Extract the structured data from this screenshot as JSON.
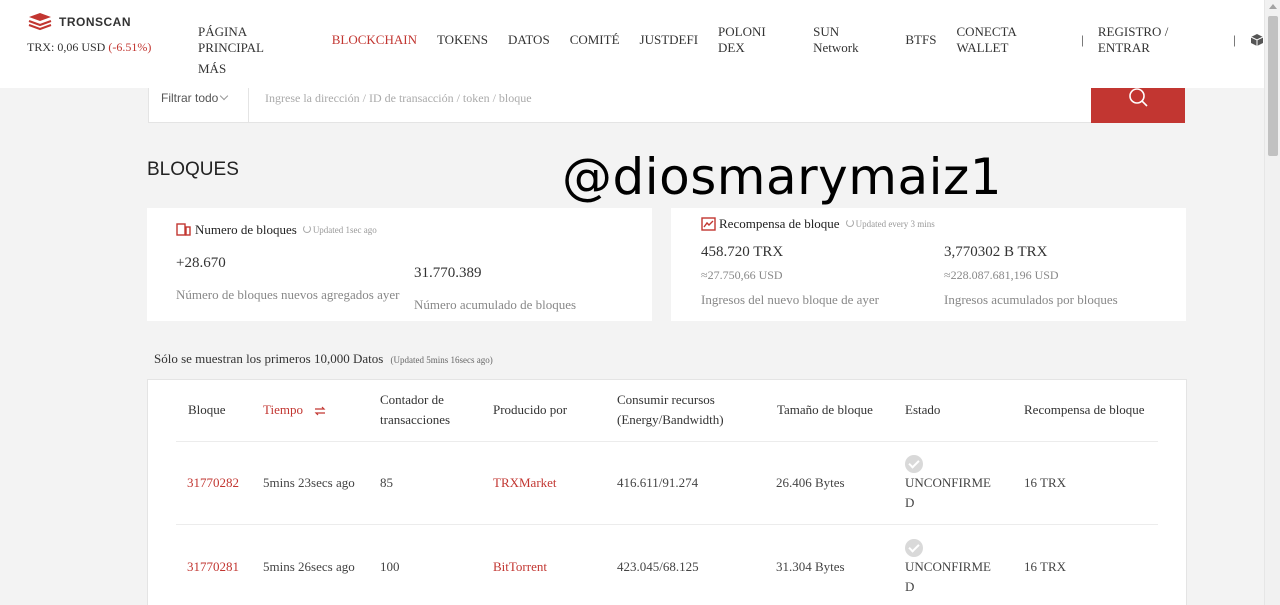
{
  "header": {
    "logo_text": "TRONSCAN",
    "trx_price": "TRX: 0,06 USD",
    "trx_change": "(-6.51%)",
    "nav": [
      "PÁGINA PRINCIPAL",
      "BLOCKCHAIN",
      "TOKENS",
      "DATOS",
      "COMITÉ",
      "JUSTDEFI",
      "POLONI DEX",
      "SUN Network",
      "BTFS",
      "CONECTA WALLET"
    ],
    "nav_active": "BLOCKCHAIN",
    "register": "REGISTRO / ENTRAR",
    "more": "MÁS",
    "separator": "|"
  },
  "search": {
    "filter": "Filtrar todo",
    "placeholder": "Ingrese la dirección / ID de transacción / token / bloque"
  },
  "page_title": "BLOQUES",
  "watermark": "@diosmarymaiz1",
  "blocks_card": {
    "title": "Numero de bloques",
    "updated": "Updated  1sec ago",
    "new_blocks": "+28.670",
    "new_blocks_label": "Número de bloques nuevos agregados ayer",
    "total_blocks": "31.770.389",
    "total_blocks_label": "Número acumulado de bloques"
  },
  "reward_card": {
    "title": "Recompensa de bloque",
    "updated": "Updated every 3 mins",
    "yesterday_trx": "458.720 TRX",
    "yesterday_usd": "≈27.750,66 USD",
    "yesterday_label": "Ingresos del nuevo bloque de ayer",
    "total_trx": "3,770302 B TRX",
    "total_usd": "≈228.087.681,196 USD",
    "total_label": "Ingresos acumulados por bloques"
  },
  "note": {
    "text": "Sólo se muestran los primeros 10,000 Datos",
    "updated": "(Updated  5mins 16secs ago)"
  },
  "table": {
    "headers": {
      "block": "Bloque",
      "time": "Tiempo",
      "tx_count_1": "Contador de",
      "tx_count_2": "transacciones",
      "producer": "Producido por",
      "resources_1": "Consumir recursos",
      "resources_2": "(Energy/Bandwidth)",
      "size": "Tamaño de bloque",
      "status": "Estado",
      "reward": "Recompensa de bloque"
    },
    "rows": [
      {
        "block": "31770282",
        "time": "5mins 23secs ago",
        "txs": "85",
        "producer": "TRXMarket",
        "resources": "416.611/91.274",
        "size": "26.406 Bytes",
        "status_1": "UNCONFIRME",
        "status_2": "D",
        "reward": "16 TRX"
      },
      {
        "block": "31770281",
        "time": "5mins 26secs ago",
        "txs": "100",
        "producer": "BitTorrent",
        "resources": "423.045/68.125",
        "size": "31.304 Bytes",
        "status_1": "UNCONFIRME",
        "status_2": "D",
        "reward": "16 TRX"
      }
    ]
  },
  "colors": {
    "accent": "#c23631",
    "background": "#f3f3f3"
  }
}
